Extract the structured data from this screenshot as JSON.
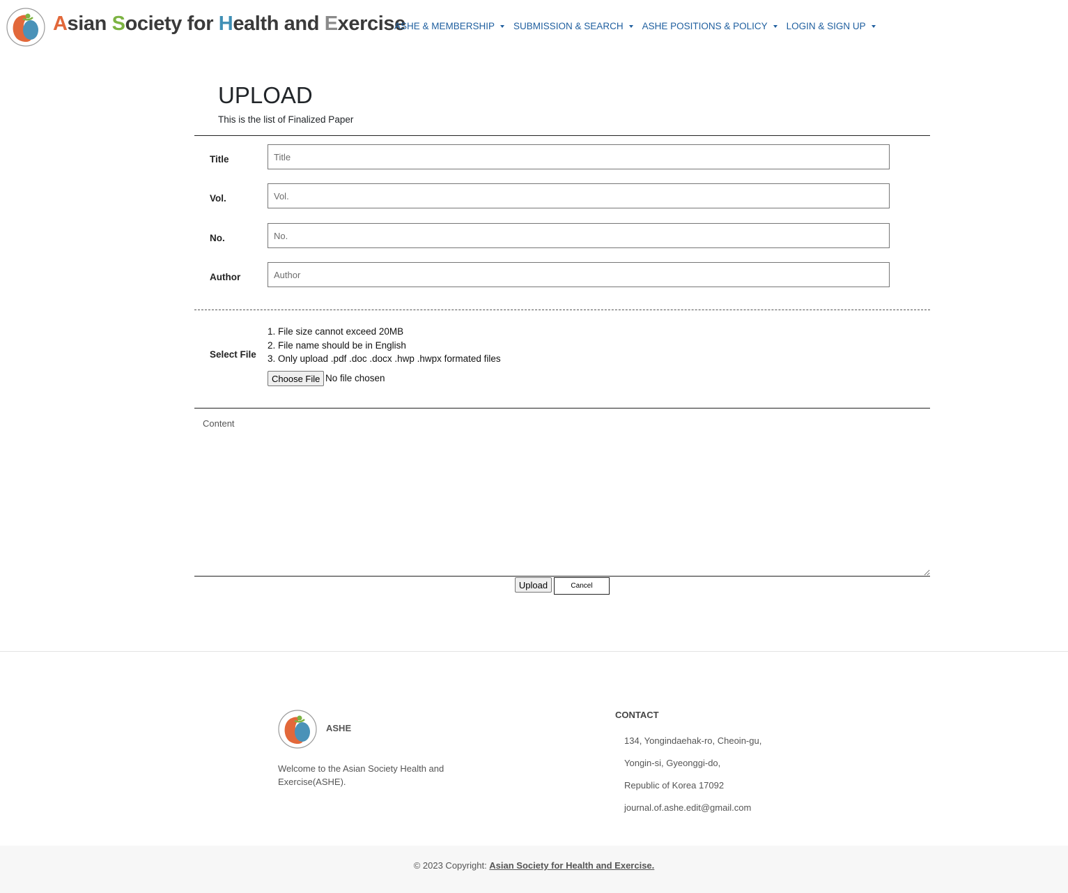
{
  "brand": {
    "letters": [
      {
        "text": "A",
        "color": "#e2683a"
      },
      {
        "text": "sian ",
        "color": "#3a3a3a"
      },
      {
        "text": "S",
        "color": "#7cb342"
      },
      {
        "text": "ociety for ",
        "color": "#3a3a3a"
      },
      {
        "text": "H",
        "color": "#3f8fb5"
      },
      {
        "text": "ealth and ",
        "color": "#3a3a3a"
      },
      {
        "text": "E",
        "color": "#8a8a8a"
      },
      {
        "text": "xercise",
        "color": "#3a3a3a"
      }
    ],
    "logo_icon": "ashe-logo-icon"
  },
  "nav": {
    "items": [
      {
        "label": "ASHE & MEMBERSHIP"
      },
      {
        "label": "SUBMISSION & SEARCH"
      },
      {
        "label": "ASHE POSITIONS & POLICY"
      },
      {
        "label": "LOGIN & SIGN UP"
      }
    ],
    "color": "#1f5f9f"
  },
  "page": {
    "title": "UPLOAD",
    "subtitle": "This is the list of Finalized Paper"
  },
  "form": {
    "title": {
      "label": "Title",
      "placeholder": "Title",
      "value": ""
    },
    "vol": {
      "label": "Vol.",
      "placeholder": "Vol.",
      "value": ""
    },
    "no": {
      "label": "No.",
      "placeholder": "No.",
      "value": ""
    },
    "author": {
      "label": "Author",
      "placeholder": "Author",
      "value": ""
    },
    "file": {
      "label": "Select File",
      "rules": [
        "1. File size cannot exceed 20MB",
        "2. File name should be in English",
        "3. Only upload .pdf .doc .docx .hwp .hwpx formated files"
      ],
      "button_label": "Choose File",
      "status": "No file chosen"
    },
    "content": {
      "placeholder": "Content",
      "value": ""
    },
    "upload_label": "Upload",
    "cancel_label": "Cancel"
  },
  "footer": {
    "brand": "ASHE",
    "welcome": "Welcome to the Asian Society Health and Exercise(ASHE).",
    "contact": {
      "heading": "CONTACT",
      "lines": [
        "134, Yongindaehak-ro, Cheoin-gu,",
        "Yongin-si, Gyeonggi-do,",
        "Republic of Korea 17092",
        "journal.of.ashe.edit@gmail.com"
      ]
    },
    "copyright_prefix": "© 2023 Copyright: ",
    "copyright_link": "Asian Society for Health and Exercise."
  }
}
